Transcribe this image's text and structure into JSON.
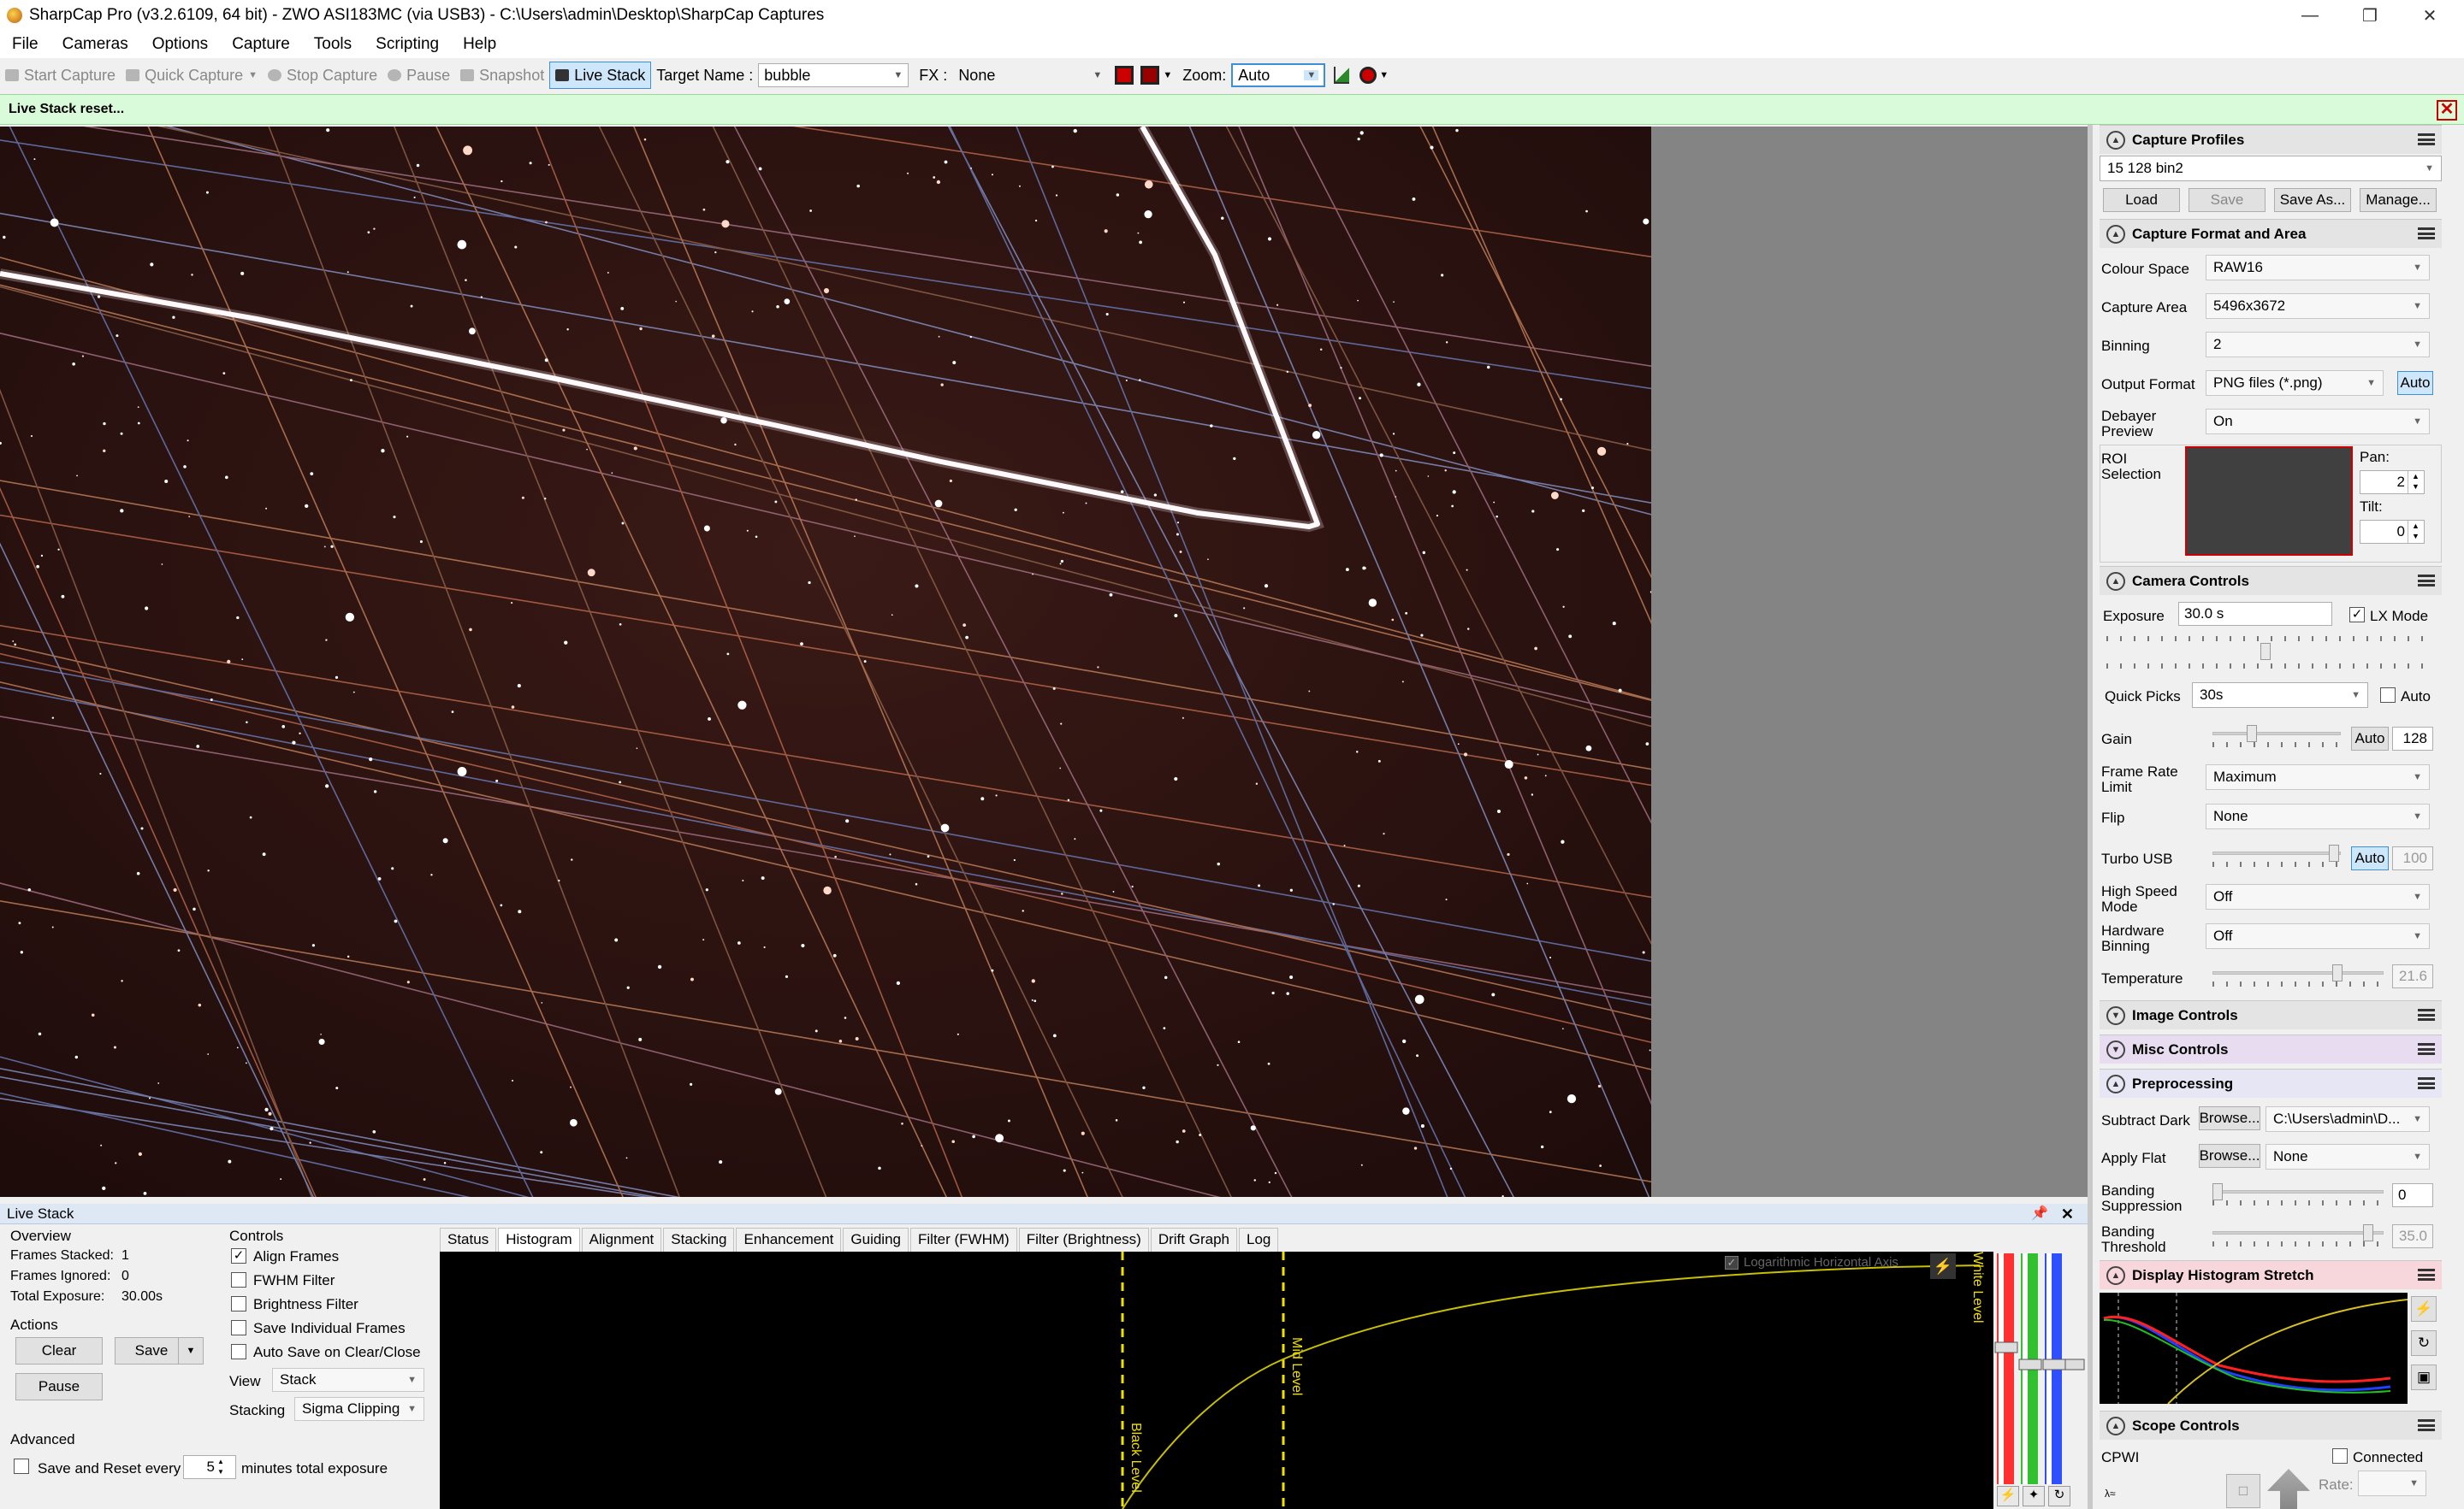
{
  "window": {
    "title": "SharpCap Pro (v3.2.6109, 64 bit) - ZWO ASI183MC (via USB3) - C:\\Users\\admin\\Desktop\\SharpCap Captures"
  },
  "menu": [
    "File",
    "Cameras",
    "Options",
    "Capture",
    "Tools",
    "Scripting",
    "Help"
  ],
  "toolbar": {
    "start_capture": "Start Capture",
    "quick_capture": "Quick Capture",
    "stop_capture": "Stop Capture",
    "pause": "Pause",
    "snapshot": "Snapshot",
    "live_stack": "Live Stack",
    "target_label": "Target Name :",
    "target_value": "bubble",
    "fx_label": "FX :",
    "fx_value": "None",
    "zoom_label": "Zoom:",
    "zoom_value": "Auto"
  },
  "notice": "Live Stack reset...",
  "panel": {
    "capture_profiles": {
      "title": "Capture Profiles",
      "selected": "15 128 bin2",
      "load": "Load",
      "save": "Save",
      "save_as": "Save As...",
      "manage": "Manage..."
    },
    "format": {
      "title": "Capture Format and Area",
      "colour_space_label": "Colour Space",
      "colour_space": "RAW16",
      "capture_area_label": "Capture Area",
      "capture_area": "5496x3672",
      "binning_label": "Binning",
      "binning": "2",
      "output_format_label": "Output Format",
      "output_format": "PNG files (*.png)",
      "auto": "Auto",
      "debayer_label_1": "Debayer",
      "debayer_label_2": "Preview",
      "debayer": "On",
      "roi_label_1": "ROI",
      "roi_label_2": "Selection",
      "pan_label": "Pan:",
      "pan": "2",
      "tilt_label": "Tilt:",
      "tilt": "0"
    },
    "camera": {
      "title": "Camera Controls",
      "exposure_label": "Exposure",
      "exposure": "30.0 s",
      "lx_mode": "LX Mode",
      "quick_picks_label": "Quick Picks",
      "quick_picks": "30s",
      "auto": "Auto",
      "gain_label": "Gain",
      "gain_auto": "Auto",
      "gain": "128",
      "frame_rate_label_1": "Frame Rate",
      "frame_rate_label_2": "Limit",
      "frame_rate": "Maximum",
      "flip_label": "Flip",
      "flip": "None",
      "turbo_label": "Turbo USB",
      "turbo_auto": "Auto",
      "turbo": "100",
      "hsm_label_1": "High Speed",
      "hsm_label_2": "Mode",
      "hsm": "Off",
      "hwbin_label_1": "Hardware",
      "hwbin_label_2": "Binning",
      "hwbin": "Off",
      "temp_label": "Temperature",
      "temp": "21.6"
    },
    "image_controls": "Image Controls",
    "misc_controls": "Misc Controls",
    "preprocessing": {
      "title": "Preprocessing",
      "dark_label": "Subtract Dark",
      "browse": "Browse...",
      "dark": "C:\\Users\\admin\\D...",
      "flat_label": "Apply Flat",
      "flat": "None",
      "banding_sup_1": "Banding",
      "banding_sup_2": "Suppression",
      "banding_sup": "0",
      "banding_thr_1": "Banding",
      "banding_thr_2": "Threshold",
      "banding_thr": "35.0"
    },
    "histogram_stretch": "Display Histogram Stretch",
    "scope": {
      "title": "Scope Controls",
      "name": "CPWI",
      "connected": "Connected",
      "rate_label": "Rate:"
    }
  },
  "livestack": {
    "title": "Live Stack",
    "overview": "Overview",
    "frames_stacked_label": "Frames Stacked:",
    "frames_stacked": "1",
    "frames_ignored_label": "Frames Ignored:",
    "frames_ignored": "0",
    "total_exposure_label": "Total Exposure:",
    "total_exposure": "30.00s",
    "actions": "Actions",
    "clear": "Clear",
    "save": "Save",
    "pause": "Pause",
    "advanced": "Advanced",
    "save_reset": "Save and Reset every",
    "save_reset_value": "5",
    "save_reset_suffix": "minutes total exposure",
    "controls": "Controls",
    "align_frames": "Align Frames",
    "fwhm_filter": "FWHM Filter",
    "brightness_filter": "Brightness Filter",
    "save_individual": "Save Individual Frames",
    "auto_save": "Auto Save on Clear/Close",
    "view_label": "View",
    "view": "Stack",
    "stacking_label": "Stacking",
    "stacking": "Sigma Clipping",
    "tabs": [
      "Status",
      "Histogram",
      "Alignment",
      "Stacking",
      "Enhancement",
      "Guiding",
      "Filter (FWHM)",
      "Filter (Brightness)",
      "Drift Graph",
      "Log"
    ],
    "log_axis": "Logarithmic Horizontal Axis",
    "black_level": "Black Level",
    "mid_level": "Mid Level",
    "white_level": "White Level"
  }
}
